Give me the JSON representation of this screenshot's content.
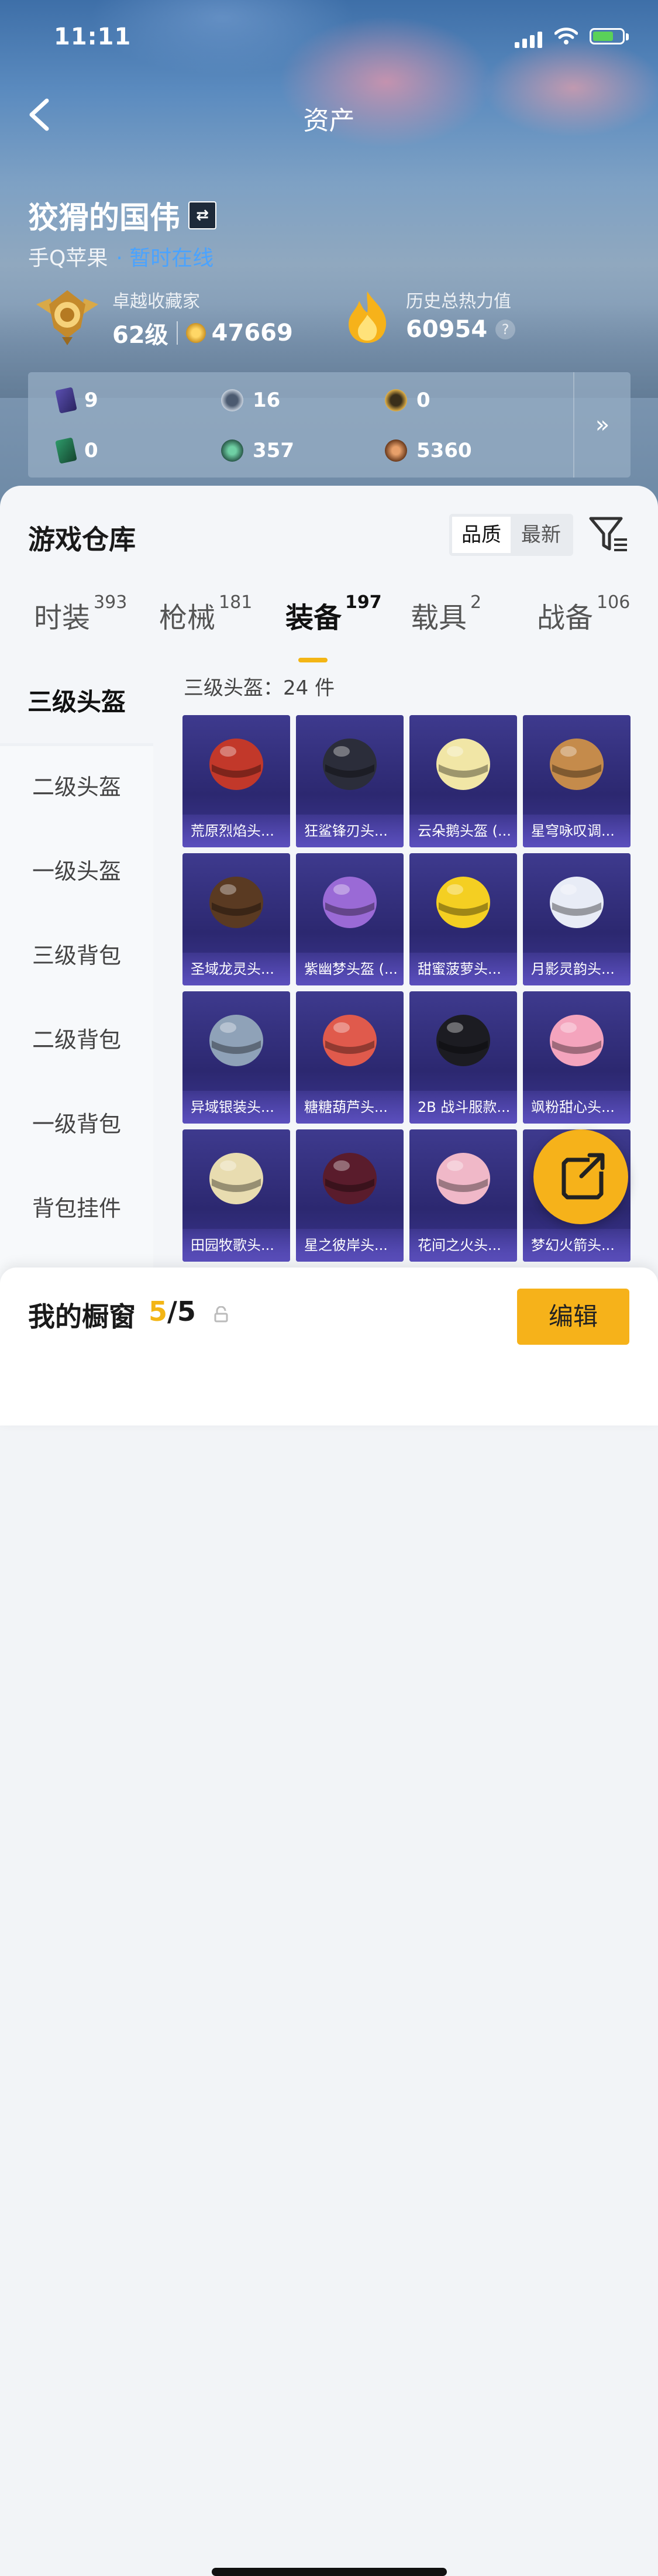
{
  "status_bar": {
    "time": "11:11"
  },
  "nav": {
    "title": "资产"
  },
  "profile": {
    "name": "狡猾的国伟",
    "platform": "手Q苹果",
    "presence": "· 暂时在线"
  },
  "collector": {
    "label": "卓越收藏家",
    "level": "62级",
    "points": "47669"
  },
  "heat": {
    "label": "历史总热力值",
    "value": "60954",
    "help": "?"
  },
  "stats": [
    {
      "icon": "purple-card-icon",
      "value": "9"
    },
    {
      "icon": "silver-coin-icon",
      "value": "16"
    },
    {
      "icon": "gold-token-icon",
      "value": "0"
    },
    {
      "icon": "green-card-icon",
      "value": "0"
    },
    {
      "icon": "green-coin-icon",
      "value": "357"
    },
    {
      "icon": "bronze-coin-icon",
      "value": "5360"
    }
  ],
  "stats_more": "»",
  "warehouse": {
    "title": "游戏仓库",
    "sort_options": [
      "品质",
      "最新"
    ],
    "sort_selected": "品质"
  },
  "tabs": [
    {
      "label": "时装",
      "count": "393"
    },
    {
      "label": "枪械",
      "count": "181"
    },
    {
      "label": "装备",
      "count": "197"
    },
    {
      "label": "载具",
      "count": "2"
    },
    {
      "label": "战备",
      "count": "106"
    }
  ],
  "active_tab": "装备",
  "sidebar": [
    "三级头盔",
    "二级头盔",
    "一级头盔",
    "三级背包",
    "二级背包",
    "一级背包",
    "背包挂件"
  ],
  "sidebar_selected": "三级头盔",
  "grid_header": "三级头盔：24 件",
  "items": [
    {
      "name": "荒原烈焰头...",
      "color": "#c2382a"
    },
    {
      "name": "狂鲨锋刃头...",
      "color": "#2b2d3a"
    },
    {
      "name": "云朵鹅头盔 (...",
      "color": "#f1e6a6"
    },
    {
      "name": "星穹咏叹调...",
      "color": "#c58b4b"
    },
    {
      "name": "圣域龙灵头...",
      "color": "#5a3a22"
    },
    {
      "name": "紫幽梦头盔 (...",
      "color": "#9a6ad6"
    },
    {
      "name": "甜蜜菠萝头...",
      "color": "#f4cf22"
    },
    {
      "name": "月影灵韵头...",
      "color": "#e8ecf6"
    },
    {
      "name": "异域银装头...",
      "color": "#8fa2b8"
    },
    {
      "name": "糖糖葫芦头...",
      "color": "#e05a4c"
    },
    {
      "name": "2B 战斗服款...",
      "color": "#1c1c22"
    },
    {
      "name": "飒粉甜心头...",
      "color": "#f4a4bd"
    },
    {
      "name": "田园牧歌头...",
      "color": "#e8dcb0"
    },
    {
      "name": "星之彼岸头...",
      "color": "#5a1c2c"
    },
    {
      "name": "花间之火头...",
      "color": "#f0b8c8"
    },
    {
      "name": "梦幻火箭头...",
      "color": "#6a5ccf"
    }
  ],
  "showcase": {
    "title": "我的橱窗",
    "current": "5",
    "total": "/5",
    "edit": "编辑"
  }
}
